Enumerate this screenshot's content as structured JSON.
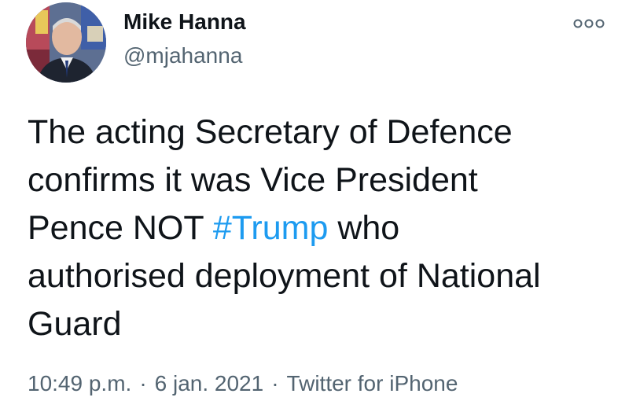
{
  "author": {
    "display_name": "Mike Hanna",
    "handle": "@mjahanna"
  },
  "menu": {
    "icon": "more-options-icon"
  },
  "tweet": {
    "line1": "The acting Secretary of Defence",
    "line2": "confirms it was Vice President",
    "line3_before": "Pence NOT ",
    "hashtag": "#Trump",
    "line3_after": " who",
    "line4": "authorised deployment of National",
    "line5": "Guard"
  },
  "meta": {
    "time": "10:49 p.m.",
    "separator": "·",
    "date": "6 jan. 2021",
    "source": "Twitter for iPhone"
  },
  "colors": {
    "text": "#0f1419",
    "secondary": "#536471",
    "link": "#1d9bf0"
  }
}
